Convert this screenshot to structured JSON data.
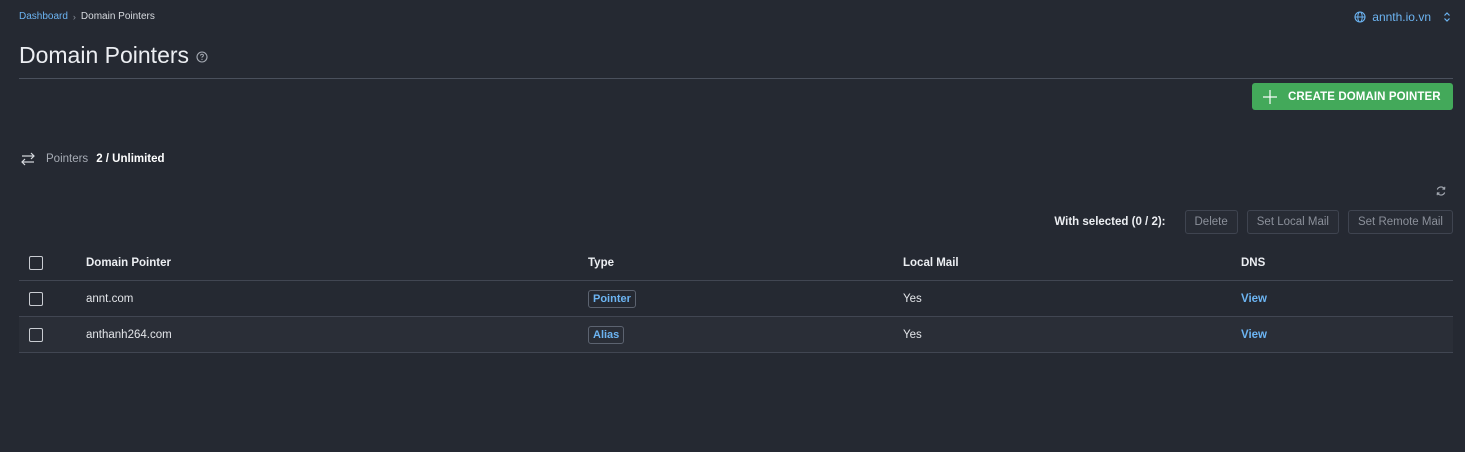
{
  "breadcrumb": {
    "home": "Dashboard",
    "current": "Domain Pointers"
  },
  "domain_selector": {
    "value": "annth.io.vn",
    "globe_icon": "globe-icon",
    "chevron_icon": "updown-chevron-icon"
  },
  "page": {
    "title": "Domain Pointers",
    "help_icon": "question-circle-icon"
  },
  "actions": {
    "create_label": "CREATE DOMAIN POINTER",
    "create_icon": "plus-icon"
  },
  "stats": {
    "label": "Pointers",
    "value": "2 / Unlimited",
    "icon": "swap-arrows-icon"
  },
  "bulk": {
    "with_selected": "With selected (0 / 2):",
    "buttons": [
      "Delete",
      "Set Local Mail",
      "Set Remote Mail"
    ]
  },
  "table": {
    "columns": [
      "Domain Pointer",
      "Type",
      "Local Mail",
      "DNS"
    ],
    "rows": [
      {
        "domain": "annt.com",
        "type": "Pointer",
        "local_mail": "Yes",
        "dns": "View"
      },
      {
        "domain": "anthanh264.com",
        "type": "Alias",
        "local_mail": "Yes",
        "dns": "View"
      }
    ]
  },
  "colors": {
    "background": "#252932",
    "accent": "#6cb4f2",
    "primary_button": "#43a95a"
  }
}
